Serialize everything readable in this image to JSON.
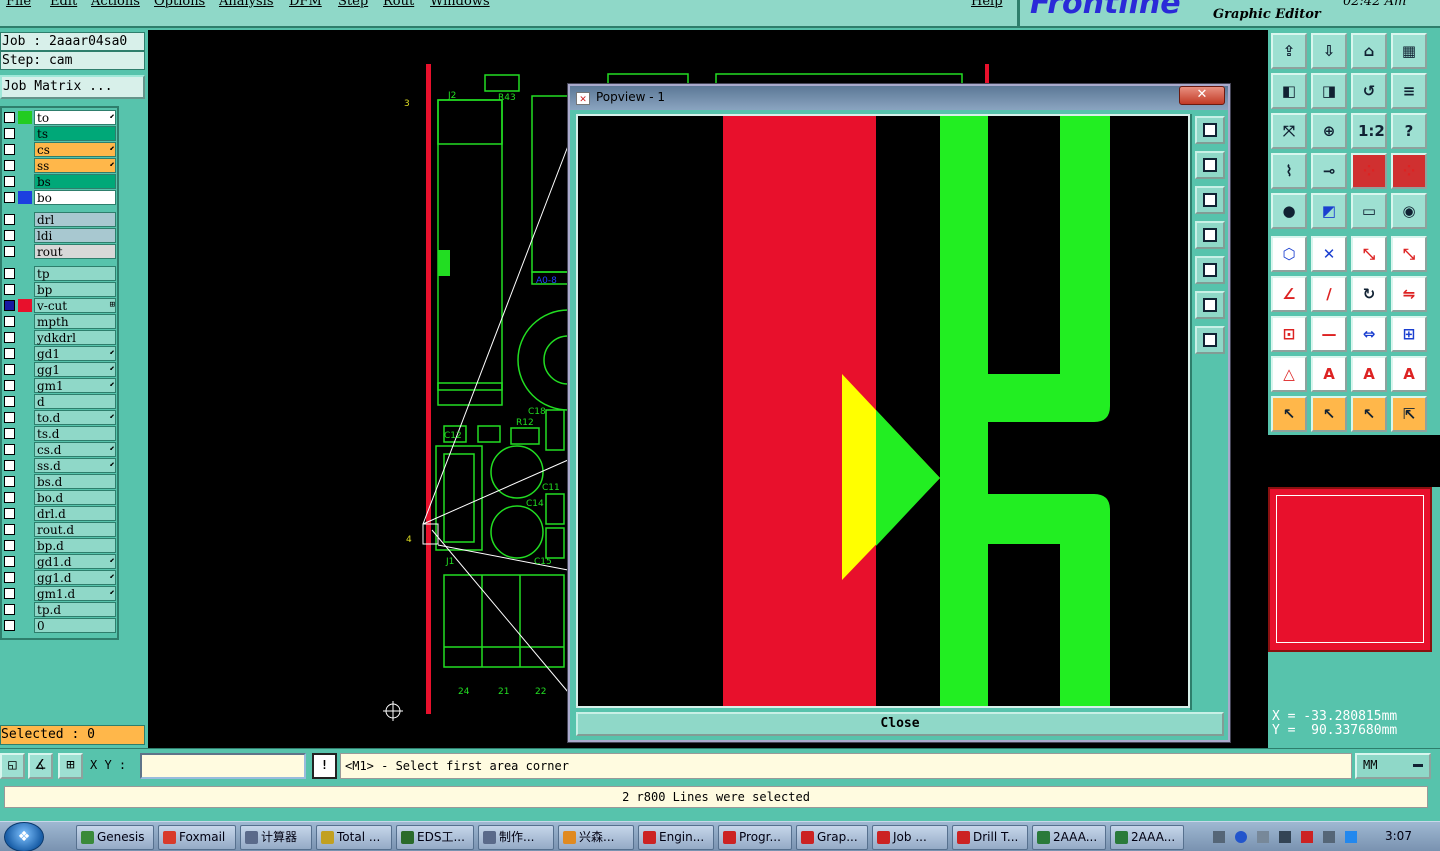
{
  "menu": [
    "File",
    "Edit",
    "Actions",
    "Options",
    "Analysis",
    "DFM",
    "Step",
    "Rout",
    "Windows",
    "Help"
  ],
  "brand": {
    "logo": "Frontline",
    "subtitle": "Graphic Editor",
    "clock": "02:42 Am"
  },
  "job": {
    "job_line": "Job : 2aaar04sa0",
    "step_line": "Step: cam",
    "matrix_button": "Job Matrix ..."
  },
  "layers": [
    {
      "name": "to",
      "color": "#ffffff",
      "swatch": "#22cc22",
      "mark": "⬋"
    },
    {
      "name": "ts",
      "color": "#00a878",
      "swatch": "",
      "mark": ""
    },
    {
      "name": "cs",
      "color": "#ffb74a",
      "swatch": "",
      "mark": "⬋"
    },
    {
      "name": "ss",
      "color": "#ffb74a",
      "swatch": "",
      "mark": "⬋"
    },
    {
      "name": "bs",
      "color": "#00a878",
      "swatch": "",
      "mark": ""
    },
    {
      "name": "bo",
      "color": "#ffffff",
      "swatch": "#1c3fe0",
      "mark": ""
    },
    {
      "name": "drl",
      "color": "#a8c8d0",
      "swatch": "",
      "mark": ""
    },
    {
      "name": "ldi",
      "color": "#a8c8d0",
      "swatch": "",
      "mark": ""
    },
    {
      "name": "rout",
      "color": "#d8d8d8",
      "swatch": "",
      "mark": ""
    },
    {
      "name": "tp",
      "color": "#8fd8c8",
      "swatch": "",
      "mark": ""
    },
    {
      "name": "bp",
      "color": "#8fd8c8",
      "swatch": "",
      "mark": ""
    },
    {
      "name": "v-cut",
      "color": "#8fd8c8",
      "swatch": "#e8102c",
      "mark": "⊞",
      "selected": true
    },
    {
      "name": "mpth",
      "color": "#8fd8c8",
      "swatch": "",
      "mark": ""
    },
    {
      "name": "ydkdrl",
      "color": "#8fd8c8",
      "swatch": "",
      "mark": ""
    },
    {
      "name": "gd1",
      "color": "#8fd8c8",
      "swatch": "",
      "mark": "⬋"
    },
    {
      "name": "gg1",
      "color": "#8fd8c8",
      "swatch": "",
      "mark": "⬋"
    },
    {
      "name": "gm1",
      "color": "#8fd8c8",
      "swatch": "",
      "mark": "⬋"
    },
    {
      "name": "d",
      "color": "#8fd8c8",
      "swatch": "",
      "mark": ""
    },
    {
      "name": "to.d",
      "color": "#8fd8c8",
      "swatch": "",
      "mark": "⬋"
    },
    {
      "name": "ts.d",
      "color": "#8fd8c8",
      "swatch": "",
      "mark": ""
    },
    {
      "name": "cs.d",
      "color": "#8fd8c8",
      "swatch": "",
      "mark": "⬋"
    },
    {
      "name": "ss.d",
      "color": "#8fd8c8",
      "swatch": "",
      "mark": "⬋"
    },
    {
      "name": "bs.d",
      "color": "#8fd8c8",
      "swatch": "",
      "mark": ""
    },
    {
      "name": "bo.d",
      "color": "#8fd8c8",
      "swatch": "",
      "mark": ""
    },
    {
      "name": "drl.d",
      "color": "#8fd8c8",
      "swatch": "",
      "mark": ""
    },
    {
      "name": "rout.d",
      "color": "#8fd8c8",
      "swatch": "",
      "mark": ""
    },
    {
      "name": "bp.d",
      "color": "#8fd8c8",
      "swatch": "",
      "mark": ""
    },
    {
      "name": "gd1.d",
      "color": "#8fd8c8",
      "swatch": "",
      "mark": "⬋"
    },
    {
      "name": "gg1.d",
      "color": "#8fd8c8",
      "swatch": "",
      "mark": "⬋"
    },
    {
      "name": "gm1.d",
      "color": "#8fd8c8",
      "swatch": "",
      "mark": "⬋"
    },
    {
      "name": "tp.d",
      "color": "#8fd8c8",
      "swatch": "",
      "mark": ""
    },
    {
      "name": "0",
      "color": "#8fd8c8",
      "swatch": "",
      "mark": ""
    }
  ],
  "selected_label": "Selected : 0",
  "canvas": {
    "labels": [
      "J2",
      "R43",
      "3",
      "4",
      "C12",
      "R12",
      "C18",
      "C11",
      "C14",
      "C15",
      "J1",
      "24",
      "21",
      "22",
      "A0-8"
    ]
  },
  "popview": {
    "title": "Popview - 1",
    "close_x": "✕",
    "close_label": "Close"
  },
  "right_tools": [
    "layer-up-icon",
    "layer-down-icon",
    "home-icon",
    "grid-icon",
    "pan-left-icon",
    "pan-right-icon",
    "flip-icon",
    "align-icon",
    "zoom-fit-icon",
    "zoom-center-icon",
    "zoom-1-2-icon",
    "help-icon",
    "measure-icon",
    "pin-icon",
    "snap-red-icon",
    "snap-red2-icon",
    "drill-icon",
    "select-net-icon",
    "ruler-icon",
    "pad-icon",
    "node-icon",
    "cross-icon",
    "line-point-icon",
    "line-point2-icon",
    "angle-icon",
    "diagonal-icon",
    "rotate-icon",
    "mirror-icon",
    "add-pad-icon",
    "dash-icon",
    "resize-icon",
    "pad-group-icon",
    "text-icon",
    "text-a-icon",
    "text-a2-icon",
    "text-a3-icon",
    "pointer-icon",
    "pointer-box-icon",
    "pointer-diag-icon",
    "pointer-move-icon"
  ],
  "right_glyphs": [
    "⇪",
    "⇩",
    "⌂",
    "▦",
    "◧",
    "◨",
    "↺",
    "≡",
    "⤧",
    "⊕",
    "1:2",
    "?",
    "⌇",
    "⊸",
    "⁘",
    "⁘",
    "●",
    "◩",
    "▭",
    "◉",
    "⬡",
    "✕",
    "⤡",
    "⤡",
    "∠",
    "∕",
    "↻",
    "⇋",
    "⊡",
    "—",
    "⇔",
    "⊞",
    "△",
    "A",
    "A",
    "A",
    "↖",
    "↖",
    "↖",
    "⇱"
  ],
  "coords": {
    "x": "X = -33.280815mm",
    "y": "Y =  90.337680mm"
  },
  "command": {
    "xy_label": "X Y :",
    "xy_value": "",
    "exclaim": "!",
    "prompt": "<M1> - Select first area corner",
    "unit": "MM"
  },
  "status": "2 r800 Lines were selected",
  "taskbar": {
    "start": "❖",
    "items": [
      "Genesis",
      "Foxmail",
      "计算器",
      "Total ...",
      "EDS工...",
      "制作...",
      "兴森...",
      "Engin...",
      "Progr...",
      "Grap...",
      "Job ...",
      "Drill T...",
      "2AAA...",
      "2AAA..."
    ],
    "item_colors": [
      "#3a8a3a",
      "#d83a2a",
      "#5a6a8a",
      "#c2a020",
      "#2a6a2a",
      "#5a6a8a",
      "#e08a20",
      "#c22",
      "#c22",
      "#c22",
      "#c22",
      "#c22",
      "#2a7a3a",
      "#2a7a3a"
    ],
    "clock": "3:07"
  },
  "colors": {
    "accent": "#57c3ac",
    "trace_green": "#22ff22",
    "vcut_red": "#e8102c",
    "highlight_yellow": "#ffff00"
  }
}
